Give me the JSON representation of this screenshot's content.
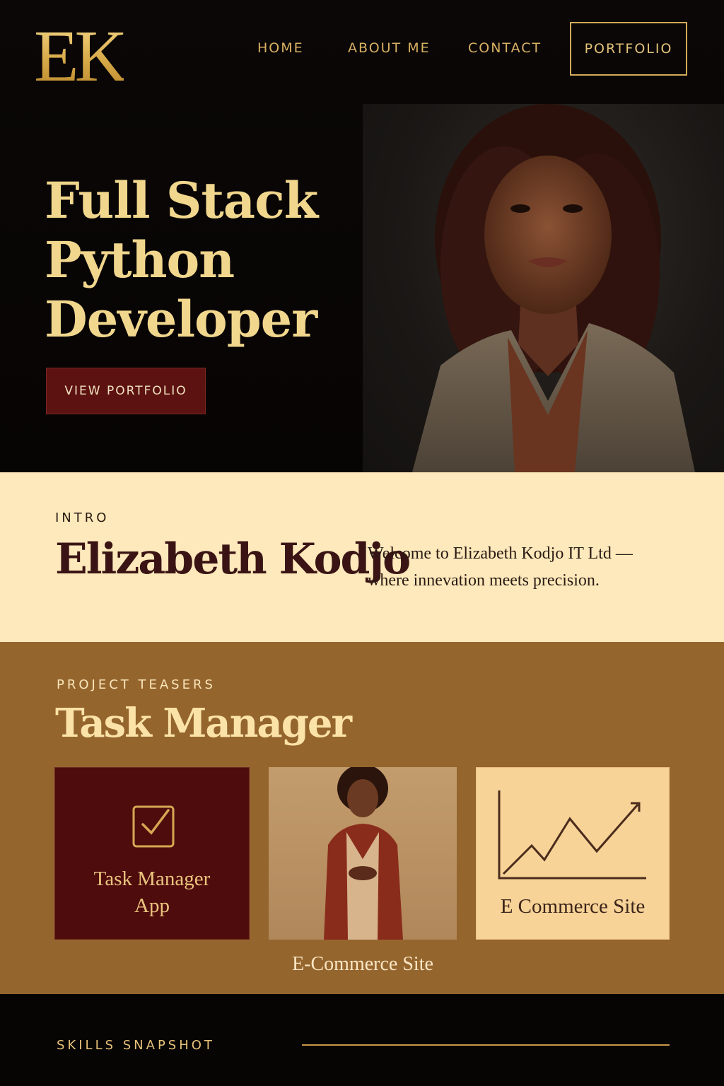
{
  "brand": {
    "logo_text": "EK"
  },
  "nav": {
    "items": [
      "HOME",
      "ABOUT ME",
      "CONTACT"
    ],
    "portfolio_label": "PORTFOLIO"
  },
  "hero": {
    "title_lines": [
      "Full Stack",
      "Python",
      "Developer"
    ],
    "cta_label": "VIEW PORTFOLIO"
  },
  "intro": {
    "eyebrow": "INTRO",
    "name": "Elizabeth Kodjo",
    "text": "Welcome to Elizabeth Kodjo IT Ltd — where innevation meets precision."
  },
  "projects": {
    "eyebrow": "PROJECT TEASERS",
    "title": "Task Manager",
    "cards": [
      {
        "label_line1": "Task Manager",
        "label_line2": "App",
        "icon": "checkbox-icon"
      },
      {
        "caption": "E-Commerce Site",
        "image": "woman-in-red-blazer-photo"
      },
      {
        "label": "E Commerce Site",
        "icon": "line-chart-icon"
      }
    ]
  },
  "skills": {
    "eyebrow": "SKILLS SNAPSHOT"
  },
  "colors": {
    "gold": "#d9b163",
    "burgundy": "#5b1210",
    "cream": "#fde9bb",
    "bronze": "#95652e",
    "black": "#070505"
  }
}
